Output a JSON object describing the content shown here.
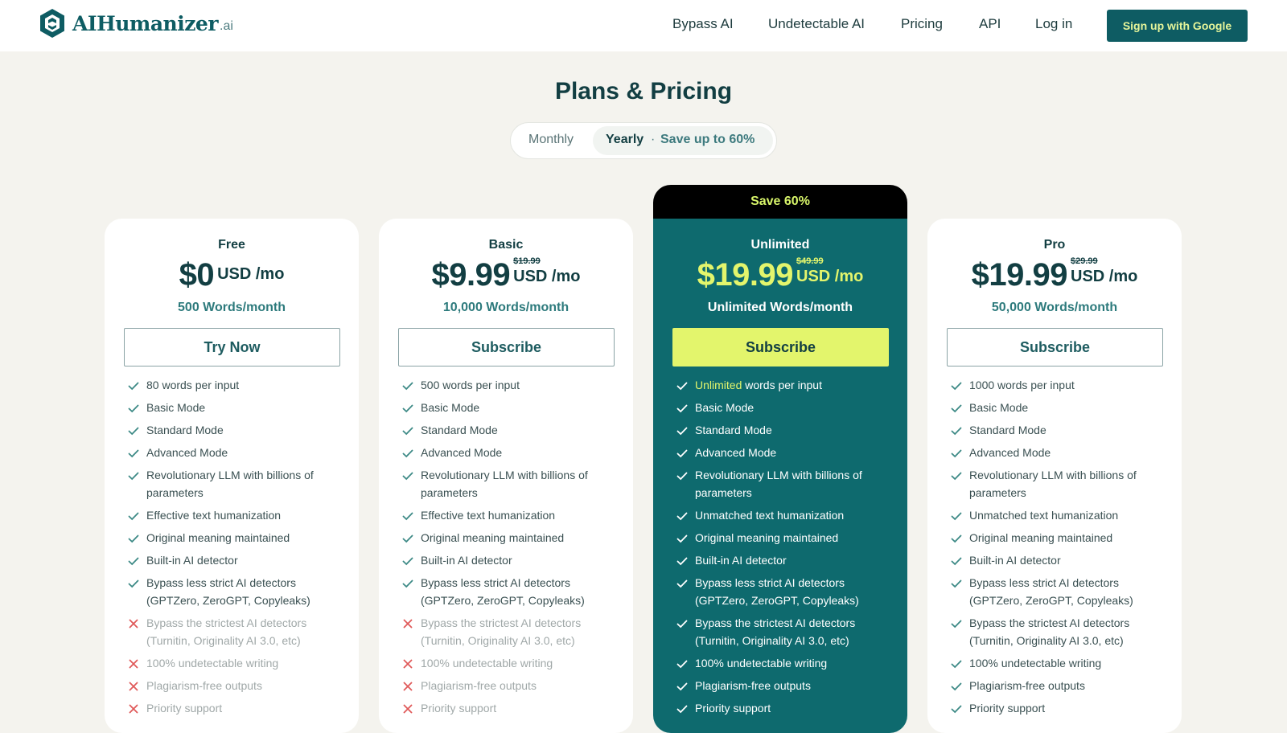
{
  "brand": {
    "name": "AIHumanizer",
    "suffix": ".ai"
  },
  "nav": {
    "links": [
      "Bypass AI",
      "Undetectable AI",
      "Pricing",
      "API",
      "Log in"
    ],
    "signup": "Sign up with Google"
  },
  "page": {
    "title": "Plans & Pricing"
  },
  "billing": {
    "monthly": "Monthly",
    "yearly": "Yearly",
    "dot": "·",
    "save": "Save up to 60%",
    "selected": "Yearly"
  },
  "colors": {
    "brand": "#0e5c63",
    "accent": "#e3f56c",
    "featured_bg": "#0e6a6e",
    "check": "#3d8a86",
    "cross": "#e05a5a"
  },
  "plans": [
    {
      "name": "Free",
      "price": "$0",
      "old_price": "",
      "unit": "USD /mo",
      "words": "500 Words/month",
      "cta": "Try Now",
      "features": [
        {
          "text": "80 words per input",
          "included": true
        },
        {
          "text": "Basic Mode",
          "included": true
        },
        {
          "text": "Standard Mode",
          "included": true
        },
        {
          "text": "Advanced Mode",
          "included": true
        },
        {
          "text": "Revolutionary LLM with billions of parameters",
          "included": true
        },
        {
          "text": "Effective text humanization",
          "included": true
        },
        {
          "text": "Original meaning maintained",
          "included": true
        },
        {
          "text": "Built-in AI detector",
          "included": true
        },
        {
          "text": "Bypass less strict AI detectors (GPTZero, ZeroGPT, Copyleaks)",
          "included": true
        },
        {
          "text": "Bypass the strictest AI detectors (Turnitin, Originality AI 3.0, etc)",
          "included": false
        },
        {
          "text": "100% undetectable writing",
          "included": false
        },
        {
          "text": "Plagiarism-free outputs",
          "included": false
        },
        {
          "text": "Priority support",
          "included": false
        }
      ]
    },
    {
      "name": "Basic",
      "price": "$9.99",
      "old_price": "$19.99",
      "unit": "USD /mo",
      "words": "10,000 Words/month",
      "cta": "Subscribe",
      "features": [
        {
          "text": "500 words per input",
          "included": true
        },
        {
          "text": "Basic Mode",
          "included": true
        },
        {
          "text": "Standard Mode",
          "included": true
        },
        {
          "text": "Advanced Mode",
          "included": true
        },
        {
          "text": "Revolutionary LLM with billions of parameters",
          "included": true
        },
        {
          "text": "Effective text humanization",
          "included": true
        },
        {
          "text": "Original meaning maintained",
          "included": true
        },
        {
          "text": "Built-in AI detector",
          "included": true
        },
        {
          "text": "Bypass less strict AI detectors (GPTZero, ZeroGPT, Copyleaks)",
          "included": true
        },
        {
          "text": "Bypass the strictest AI detectors (Turnitin, Originality AI 3.0, etc)",
          "included": false
        },
        {
          "text": "100% undetectable writing",
          "included": false
        },
        {
          "text": "Plagiarism-free outputs",
          "included": false
        },
        {
          "text": "Priority support",
          "included": false
        }
      ]
    },
    {
      "name": "Unlimited",
      "banner": "Save 60%",
      "price": "$19.99",
      "old_price": "$49.99",
      "unit": "USD /mo",
      "words": "Unlimited Words/month",
      "cta": "Subscribe",
      "features": [
        {
          "text": "words per input",
          "highlight": "Unlimited",
          "included": true
        },
        {
          "text": "Basic Mode",
          "included": true
        },
        {
          "text": "Standard Mode",
          "included": true
        },
        {
          "text": "Advanced Mode",
          "included": true
        },
        {
          "text": "Revolutionary LLM with billions of parameters",
          "included": true
        },
        {
          "text": "Unmatched text humanization",
          "included": true
        },
        {
          "text": "Original meaning maintained",
          "included": true
        },
        {
          "text": "Built-in AI detector",
          "included": true
        },
        {
          "text": "Bypass less strict AI detectors (GPTZero, ZeroGPT, Copyleaks)",
          "included": true
        },
        {
          "text": "Bypass the strictest AI detectors (Turnitin, Originality AI 3.0, etc)",
          "included": true
        },
        {
          "text": "100% undetectable writing",
          "included": true
        },
        {
          "text": "Plagiarism-free outputs",
          "included": true
        },
        {
          "text": "Priority support",
          "included": true
        }
      ]
    },
    {
      "name": "Pro",
      "price": "$19.99",
      "old_price": "$29.99",
      "unit": "USD /mo",
      "words": "50,000 Words/month",
      "cta": "Subscribe",
      "features": [
        {
          "text": "1000 words per input",
          "included": true
        },
        {
          "text": "Basic Mode",
          "included": true
        },
        {
          "text": "Standard Mode",
          "included": true
        },
        {
          "text": "Advanced Mode",
          "included": true
        },
        {
          "text": "Revolutionary LLM with billions of parameters",
          "included": true
        },
        {
          "text": "Unmatched text humanization",
          "included": true
        },
        {
          "text": "Original meaning maintained",
          "included": true
        },
        {
          "text": "Built-in AI detector",
          "included": true
        },
        {
          "text": "Bypass less strict AI detectors (GPTZero, ZeroGPT, Copyleaks)",
          "included": true
        },
        {
          "text": "Bypass the strictest AI detectors (Turnitin, Originality AI 3.0, etc)",
          "included": true
        },
        {
          "text": "100% undetectable writing",
          "included": true
        },
        {
          "text": "Plagiarism-free outputs",
          "included": true
        },
        {
          "text": "Priority support",
          "included": true
        }
      ]
    }
  ]
}
